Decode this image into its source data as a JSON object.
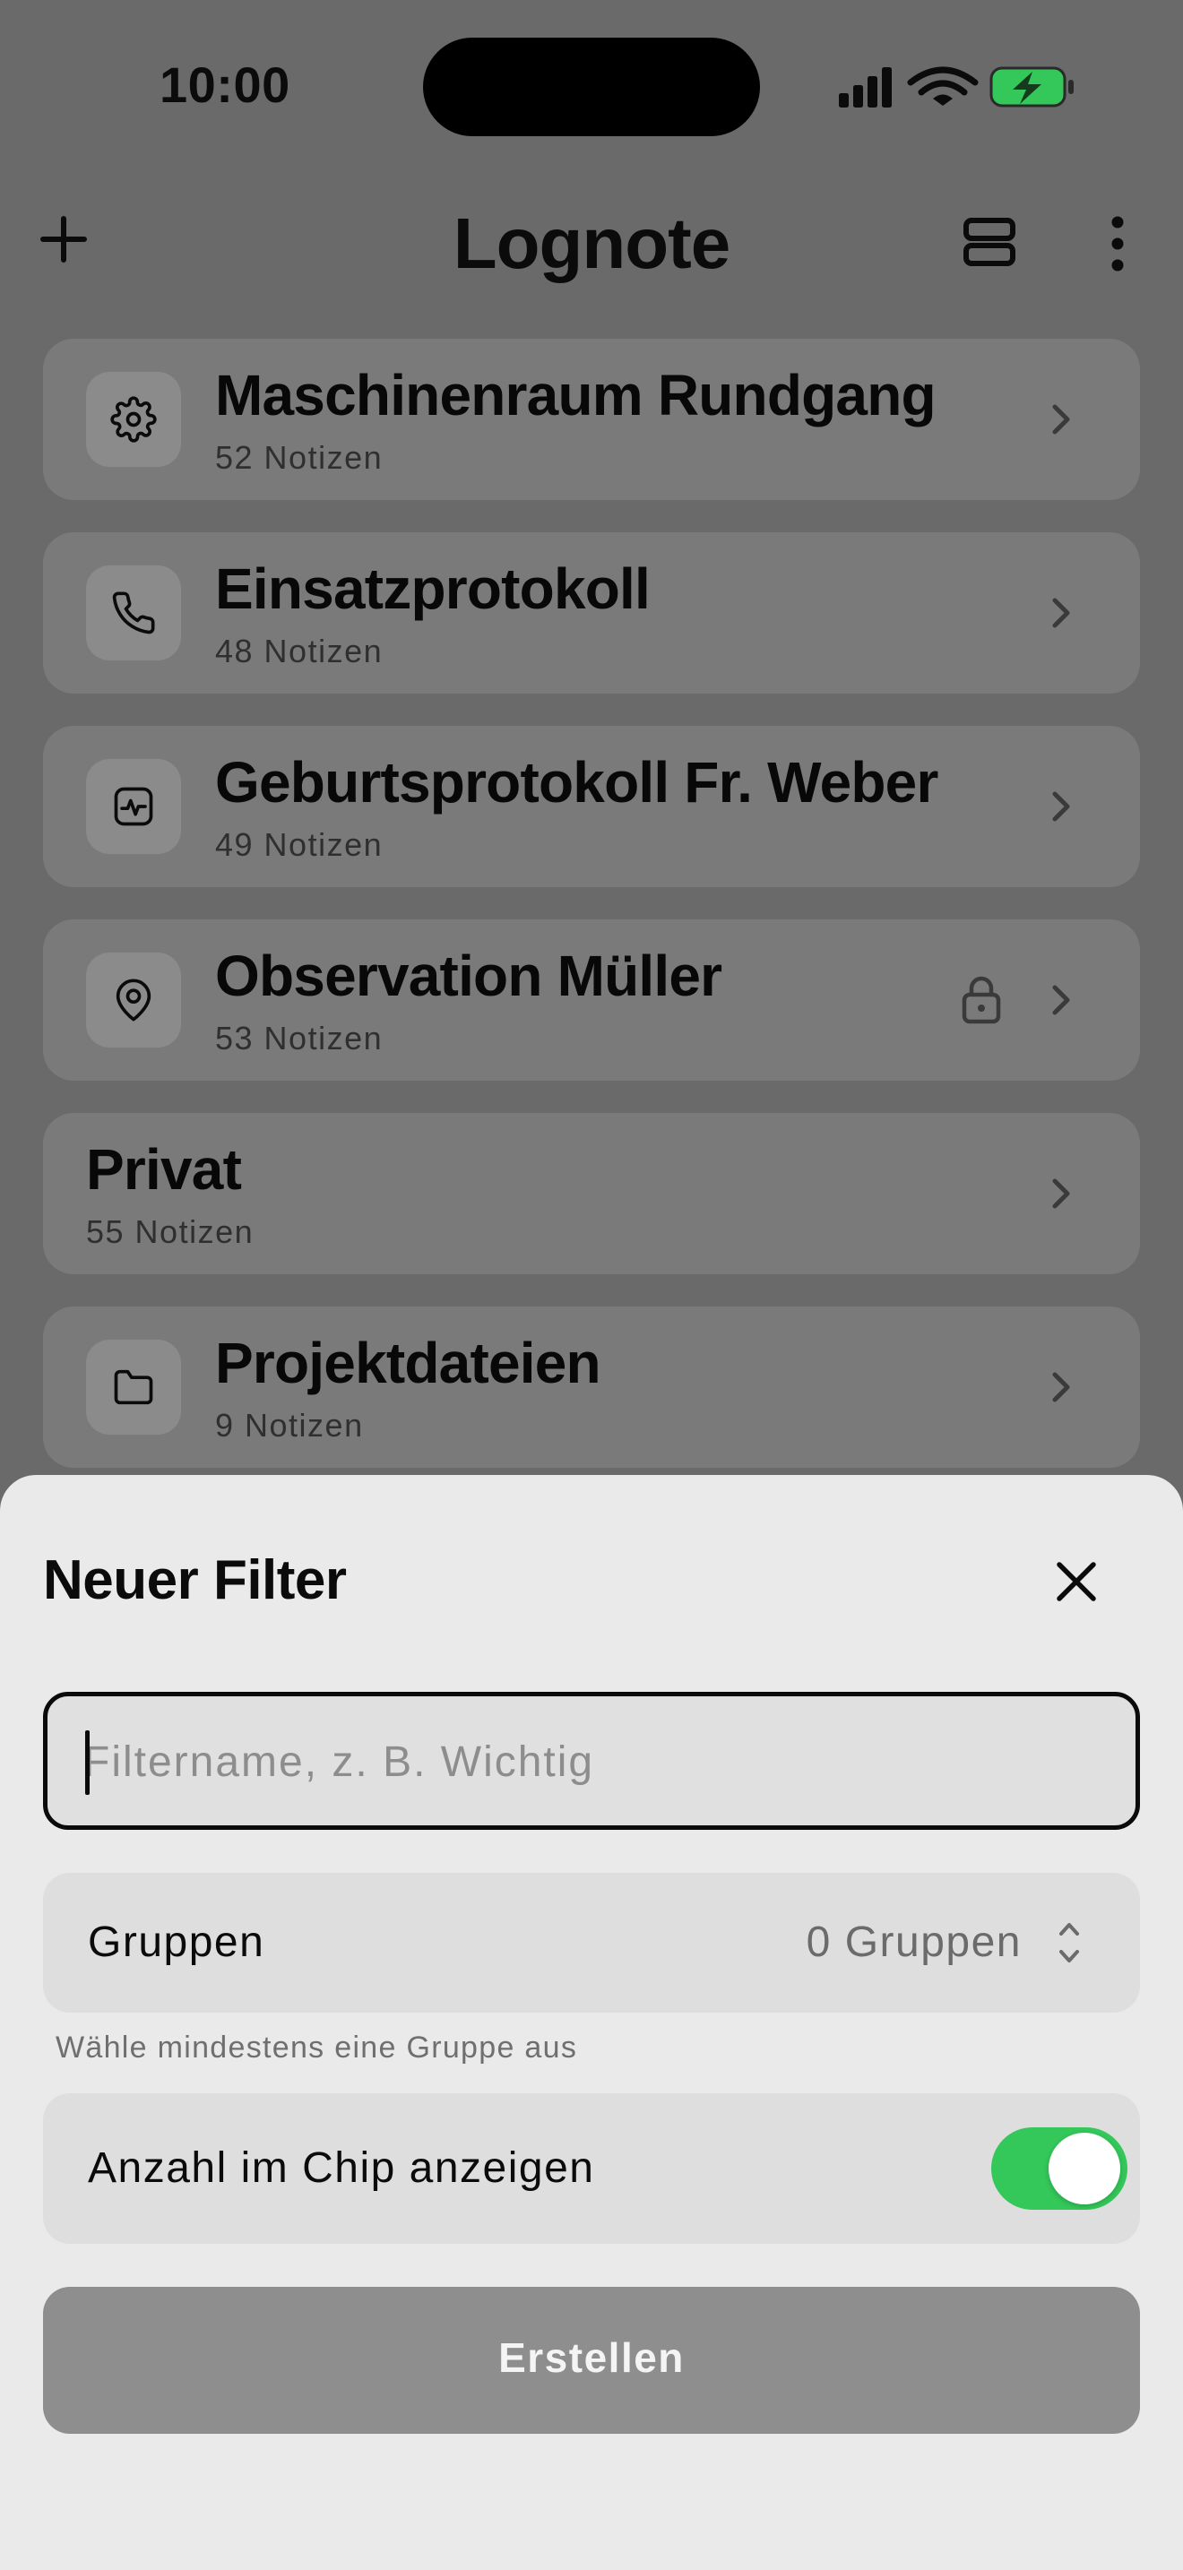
{
  "status_bar": {
    "time": "10:00",
    "icons": [
      "signal-icon",
      "wifi-icon",
      "battery-charging-icon"
    ],
    "battery_color": "#34c759"
  },
  "nav": {
    "title": "Lognote",
    "left_icon": "plus-icon",
    "right_icons": [
      "layout-rows-icon",
      "more-vertical-icon"
    ]
  },
  "groups": [
    {
      "title": "Maschinenraum Rundgang",
      "count": "52 Notizen",
      "icon": "gear-icon",
      "locked": false
    },
    {
      "title": "Einsatzprotokoll",
      "count": "48 Notizen",
      "icon": "phone-icon",
      "locked": false
    },
    {
      "title": "Geburtsprotokoll Fr. Weber",
      "count": "49 Notizen",
      "icon": "activity-monitor-icon",
      "locked": false
    },
    {
      "title": "Observation Müller",
      "count": "53 Notizen",
      "icon": "map-pin-icon",
      "locked": true
    },
    {
      "title": "Privat",
      "count": "55 Notizen",
      "icon": null,
      "locked": false
    },
    {
      "title": "Projektdateien",
      "count": "9 Notizen",
      "icon": "folder-icon",
      "locked": false
    }
  ],
  "sheet": {
    "title": "Neuer Filter",
    "name_input": {
      "value": "",
      "placeholder": "Filtername, z. B. Wichtig"
    },
    "groups_field": {
      "label": "Gruppen",
      "value": "0 Gruppen"
    },
    "hint": "Wähle mindestens eine Gruppe aus",
    "show_count": {
      "label": "Anzahl im Chip anzeigen",
      "enabled": true
    },
    "create_label": "Erstellen",
    "accent_color": "#34c759"
  }
}
